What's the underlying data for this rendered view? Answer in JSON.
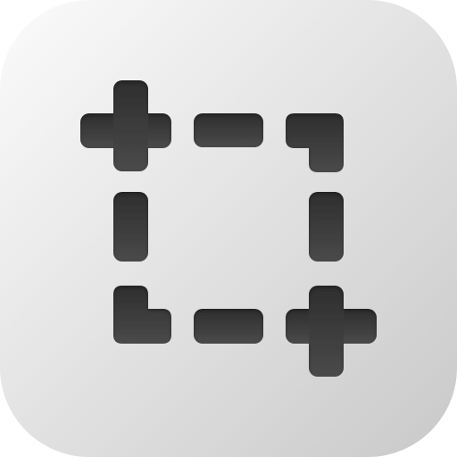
{
  "icon": {
    "name": "screenshot-selection-icon",
    "colors": {
      "background_top": "#fbfbfb",
      "background_bottom": "#c9c9c9",
      "glyph": "#4a4a4a",
      "glyph_shadow": "#2e2e2e"
    }
  }
}
